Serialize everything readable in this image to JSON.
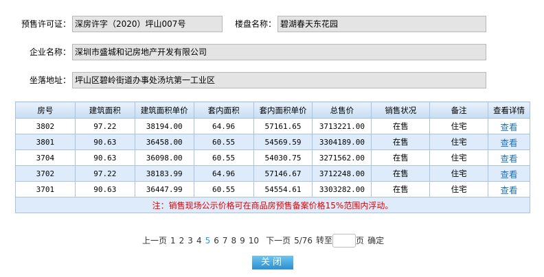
{
  "form": {
    "permit_label": "预售许可证：",
    "permit_value": "深房许字（2020）坪山007号",
    "project_label": "楼盘名称：",
    "project_value": "碧湖春天东花园",
    "company_label": "企业名称：",
    "company_value": "深圳市盛城和记房地产开发有限公司",
    "location_label": "坐落地址：",
    "location_value": "坪山区碧岭街道办事处汤坑第一工业区"
  },
  "table": {
    "headers": [
      "房号",
      "建筑面积",
      "建筑面积单价",
      "套内面积",
      "套内面积单价",
      "总售价",
      "销售状况",
      "备注",
      "查看详情"
    ],
    "rows": [
      [
        "3802",
        "97.22",
        "38194.00",
        "64.96",
        "57161.65",
        "3713221.00",
        "在售",
        "住宅",
        "查看"
      ],
      [
        "3801",
        "90.63",
        "36458.00",
        "60.55",
        "54569.59",
        "3304189.00",
        "在售",
        "住宅",
        "查看"
      ],
      [
        "3704",
        "90.63",
        "36098.00",
        "60.55",
        "54030.75",
        "3271562.00",
        "在售",
        "住宅",
        "查看"
      ],
      [
        "3702",
        "97.22",
        "38183.99",
        "64.96",
        "57146.67",
        "3712248.00",
        "在售",
        "住宅",
        "查看"
      ],
      [
        "3701",
        "90.63",
        "36447.99",
        "60.55",
        "54554.61",
        "3303282.00",
        "在售",
        "住宅",
        "查看"
      ]
    ],
    "note": "注：销售现场公示价格可在商品房预售备案价格15%范围内浮动。"
  },
  "pager": {
    "prev": "上一页",
    "pages": [
      "1",
      "2",
      "3",
      "4",
      "5",
      "6",
      "7",
      "8",
      "9",
      "10"
    ],
    "current": "5",
    "next": "下一页",
    "info": "5/76",
    "goto": "转至",
    "page_unit": "页",
    "confirm": "确定"
  },
  "close_label": "关闭"
}
